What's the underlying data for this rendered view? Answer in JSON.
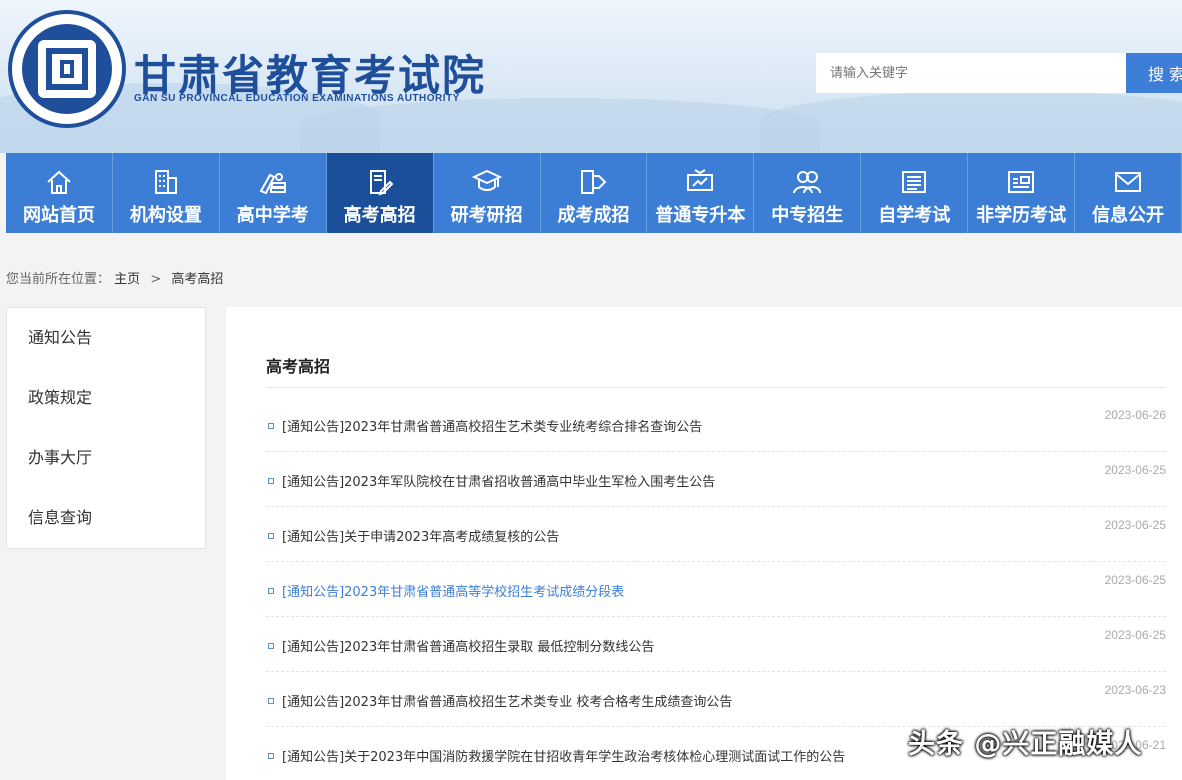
{
  "header": {
    "title_cn": "甘肃省教育考试院",
    "title_en": "GAN SU PROVINCAL EDUCATION EXAMINATIONS AUTHORITY",
    "search_placeholder": "请输入关键字",
    "search_button": "搜 索"
  },
  "nav": {
    "items": [
      {
        "label": "网站首页",
        "icon": "home-icon"
      },
      {
        "label": "机构设置",
        "icon": "building-icon"
      },
      {
        "label": "高中学考",
        "icon": "books-icon"
      },
      {
        "label": "高考高招",
        "icon": "exam-paper-icon"
      },
      {
        "label": "研考研招",
        "icon": "graduation-cap-icon"
      },
      {
        "label": "成考成招",
        "icon": "book-arrow-icon"
      },
      {
        "label": "普通专升本",
        "icon": "presentation-icon"
      },
      {
        "label": "中专招生",
        "icon": "people-icon"
      },
      {
        "label": "自学考试",
        "icon": "document-icon"
      },
      {
        "label": "非学历考试",
        "icon": "id-card-icon"
      },
      {
        "label": "信息公开",
        "icon": "mail-icon"
      }
    ],
    "active": "高考高招"
  },
  "breadcrumb": {
    "prefix": "您当前所在位置：",
    "home": "主页",
    "sep": ">",
    "current": "高考高招"
  },
  "sidebar": {
    "items": [
      "通知公告",
      "政策规定",
      "办事大厅",
      "信息查询"
    ]
  },
  "main": {
    "title": "高考高招",
    "items": [
      {
        "title": "[通知公告]2023年甘肃省普通高校招生艺术类专业统考综合排名查询公告",
        "date": "2023-06-26"
      },
      {
        "title": "[通知公告]2023年军队院校在甘肃省招收普通高中毕业生军检入围考生公告",
        "date": "2023-06-25"
      },
      {
        "title": "[通知公告]关于申请2023年高考成绩复核的公告",
        "date": "2023-06-25"
      },
      {
        "title": "[通知公告]2023年甘肃省普通高等学校招生考试成绩分段表",
        "date": "2023-06-25"
      },
      {
        "title": "[通知公告]2023年甘肃省普通高校招生录取 最低控制分数线公告",
        "date": "2023-06-25"
      },
      {
        "title": "[通知公告]2023年甘肃省普通高校招生艺术类专业 校考合格考生成绩查询公告",
        "date": "2023-06-23"
      },
      {
        "title": "[通知公告]关于2023年中国消防救援学院在甘招收青年学生政治考核体检心理测试面试工作的公告",
        "date": "2023-06-21"
      }
    ]
  },
  "watermark": "头条 @兴正融媒人",
  "colors": {
    "brand": "#1f4f9b",
    "nav": "#3c7ed6",
    "nav_active": "#1b4f99",
    "link_highlight": "#3d7ed8"
  }
}
